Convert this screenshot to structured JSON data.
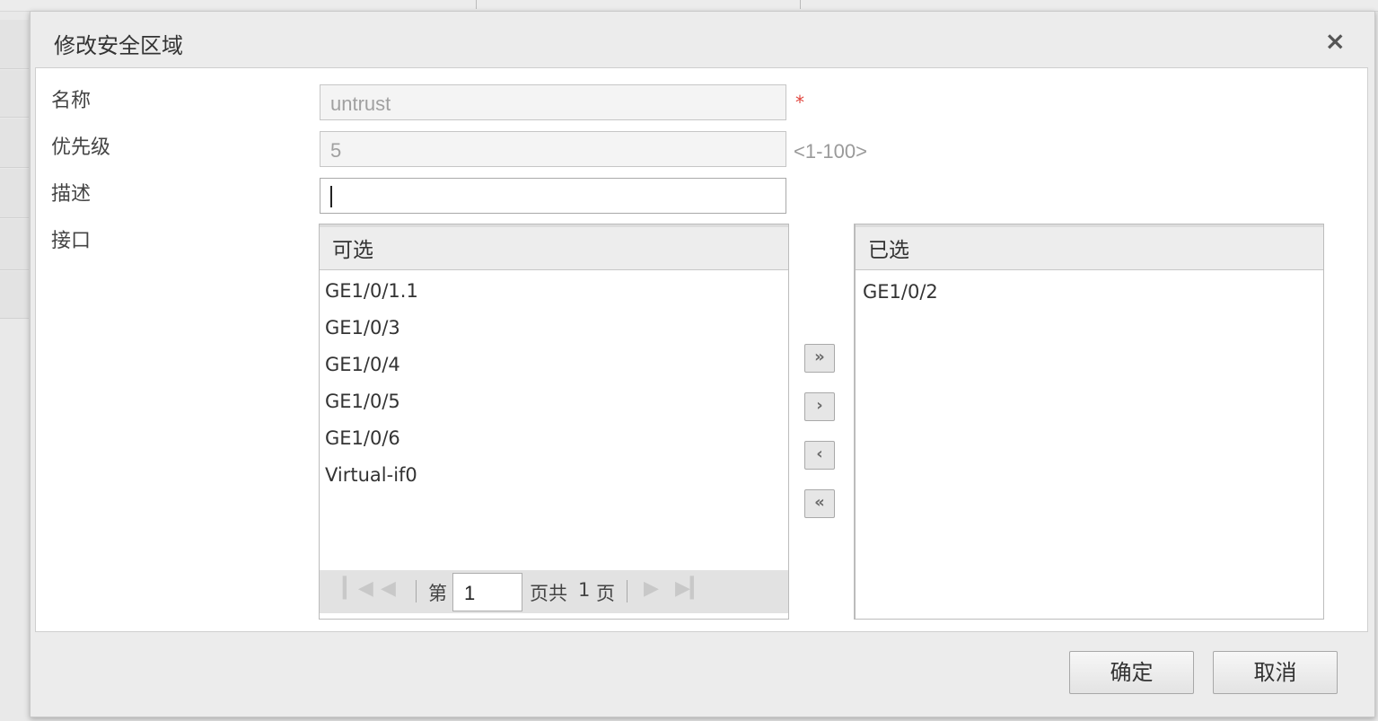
{
  "dialog": {
    "title": "修改安全区域",
    "close_icon": "×"
  },
  "form": {
    "name_label": "名称",
    "name_value": "untrust",
    "required_mark": "*",
    "priority_label": "优先级",
    "priority_value": "5",
    "priority_range": "<1-100>",
    "desc_label": "描述",
    "desc_value": "",
    "interface_label": "接口"
  },
  "available": {
    "header": "可选",
    "items": [
      "GE1/0/1.1",
      "GE1/0/3",
      "GE1/0/4",
      "GE1/0/5",
      "GE1/0/6",
      "Virtual-if0"
    ]
  },
  "selected": {
    "header": "已选",
    "items": [
      "GE1/0/2"
    ]
  },
  "transfer": {
    "add_all": "»",
    "add": "›",
    "remove": "‹",
    "remove_all": "«"
  },
  "pager": {
    "first_icon": "first-page-icon",
    "prev_icon": "prev-page-icon",
    "next_icon": "next-page-icon",
    "last_icon": "last-page-icon",
    "prefix": "第",
    "current_page": "1",
    "suffix_before": "页共",
    "total_pages": "1",
    "suffix_after": "页"
  },
  "footer": {
    "ok_label": "确定",
    "cancel_label": "取消"
  },
  "colors": {
    "required": "#e0443c",
    "dialog_bg": "#ececec",
    "panel_header_bg": "#ededed"
  }
}
